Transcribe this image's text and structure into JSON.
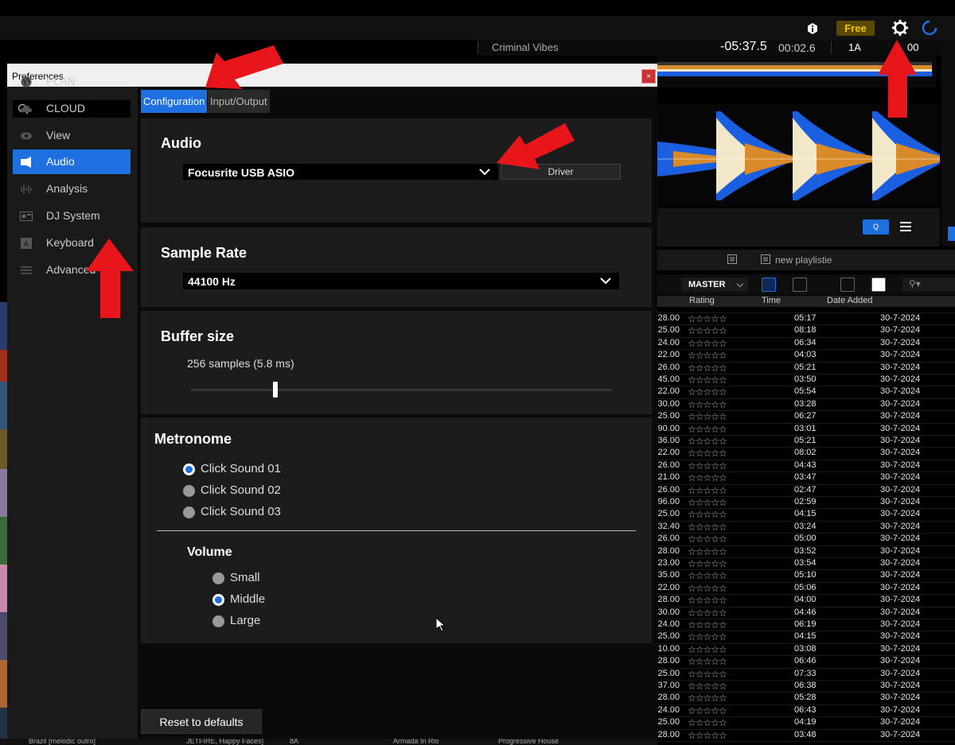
{
  "app": {
    "free_badge": "Free",
    "deck": {
      "track_title": "Criminal Vibes",
      "remaining": "-05:37.5",
      "elapsed": "00:02.6",
      "key": "1A",
      "bpm": "00"
    },
    "q_button": "Q",
    "playlist_name": "new playlistie",
    "master_label": "MASTER",
    "columns": [
      "Rating",
      "Time",
      "Date Added"
    ],
    "tracks": [
      {
        "bpm": "28.00",
        "time": "05:17",
        "date": "30-7-2024"
      },
      {
        "bpm": "25.00",
        "time": "08:18",
        "date": "30-7-2024"
      },
      {
        "bpm": "24.00",
        "time": "06:34",
        "date": "30-7-2024"
      },
      {
        "bpm": "22.00",
        "time": "04:03",
        "date": "30-7-2024"
      },
      {
        "bpm": "26.00",
        "time": "05:21",
        "date": "30-7-2024"
      },
      {
        "bpm": "45.00",
        "time": "03:50",
        "date": "30-7-2024"
      },
      {
        "bpm": "22.00",
        "time": "05:54",
        "date": "30-7-2024"
      },
      {
        "bpm": "30.00",
        "time": "03:28",
        "date": "30-7-2024"
      },
      {
        "bpm": "25.00",
        "time": "06:27",
        "date": "30-7-2024"
      },
      {
        "bpm": "90.00",
        "time": "03:01",
        "date": "30-7-2024"
      },
      {
        "bpm": "36.00",
        "time": "05:21",
        "date": "30-7-2024"
      },
      {
        "bpm": "22.00",
        "time": "08:02",
        "date": "30-7-2024"
      },
      {
        "bpm": "26.00",
        "time": "04:43",
        "date": "30-7-2024"
      },
      {
        "bpm": "21.00",
        "time": "03:47",
        "date": "30-7-2024"
      },
      {
        "bpm": "26.00",
        "time": "02:47",
        "date": "30-7-2024"
      },
      {
        "bpm": "96.00",
        "time": "02:59",
        "date": "30-7-2024"
      },
      {
        "bpm": "25.00",
        "time": "04:15",
        "date": "30-7-2024"
      },
      {
        "bpm": "32.40",
        "time": "03:24",
        "date": "30-7-2024"
      },
      {
        "bpm": "26.00",
        "time": "05:00",
        "date": "30-7-2024"
      },
      {
        "bpm": "28.00",
        "time": "03:52",
        "date": "30-7-2024"
      },
      {
        "bpm": "23.00",
        "time": "03:54",
        "date": "30-7-2024"
      },
      {
        "bpm": "35.00",
        "time": "05:10",
        "date": "30-7-2024"
      },
      {
        "bpm": "22.00",
        "time": "05:06",
        "date": "30-7-2024"
      },
      {
        "bpm": "28.00",
        "time": "04:00",
        "date": "30-7-2024"
      },
      {
        "bpm": "30.00",
        "time": "04:46",
        "date": "30-7-2024"
      },
      {
        "bpm": "24.00",
        "time": "06:19",
        "date": "30-7-2024"
      },
      {
        "bpm": "25.00",
        "time": "04:15",
        "date": "30-7-2024"
      },
      {
        "bpm": "10.00",
        "time": "03:08",
        "date": "30-7-2024"
      },
      {
        "bpm": "28.00",
        "time": "06:46",
        "date": "30-7-2024"
      },
      {
        "bpm": "25.00",
        "time": "07:33",
        "date": "30-7-2024"
      },
      {
        "bpm": "37.00",
        "time": "06:38",
        "date": "30-7-2024"
      },
      {
        "bpm": "28.00",
        "time": "05:28",
        "date": "30-7-2024"
      },
      {
        "bpm": "24.00",
        "time": "06:43",
        "date": "30-7-2024"
      },
      {
        "bpm": "25.00",
        "time": "04:19",
        "date": "30-7-2024"
      },
      {
        "bpm": "28.00",
        "time": "03:48",
        "date": "30-7-2024"
      }
    ],
    "bottom_row": [
      "Brazil [melodic outro]",
      "JETFIRE, Happy Faces]",
      "8A",
      "Armada In Rio",
      "Progressive House"
    ]
  },
  "preferences": {
    "title": "Preferences",
    "close_label": "×",
    "sidebar": [
      {
        "label": "PLAN",
        "icon": "globe-icon"
      },
      {
        "label": "CLOUD",
        "icon": "cloud-icon"
      },
      {
        "label": "View",
        "icon": "eye-icon"
      },
      {
        "label": "Audio",
        "icon": "speaker-icon",
        "active": true
      },
      {
        "label": "Analysis",
        "icon": "waveform-icon"
      },
      {
        "label": "DJ System",
        "icon": "dj-system-icon"
      },
      {
        "label": "Keyboard",
        "icon": "keyboard-icon"
      },
      {
        "label": "Advanced",
        "icon": "list-icon"
      }
    ],
    "tabs": [
      {
        "label": "Configuration",
        "active": true
      },
      {
        "label": "Input/Output",
        "active": false
      }
    ],
    "audio": {
      "heading": "Audio",
      "device": "Focusrite USB ASIO",
      "driver_button": "Driver"
    },
    "sample_rate": {
      "heading": "Sample Rate",
      "value": "44100 Hz"
    },
    "buffer": {
      "heading": "Buffer size",
      "value_text": "256 samples (5.8 ms)",
      "slider_fraction": 0.2
    },
    "metronome": {
      "heading": "Metronome",
      "sounds": [
        {
          "label": "Click Sound 01",
          "selected": true
        },
        {
          "label": "Click Sound 02",
          "selected": false
        },
        {
          "label": "Click Sound 03",
          "selected": false
        }
      ],
      "volume_heading": "Volume",
      "volumes": [
        {
          "label": "Small",
          "selected": false
        },
        {
          "label": "Middle",
          "selected": true
        },
        {
          "label": "Large",
          "selected": false
        }
      ]
    },
    "reset_button": "Reset to defaults"
  },
  "colors": {
    "accent": "#1e6fe0",
    "annotation_arrow": "#e8161b",
    "waveform_blue": "#1a5fe0",
    "waveform_orange": "#d98a2b"
  }
}
